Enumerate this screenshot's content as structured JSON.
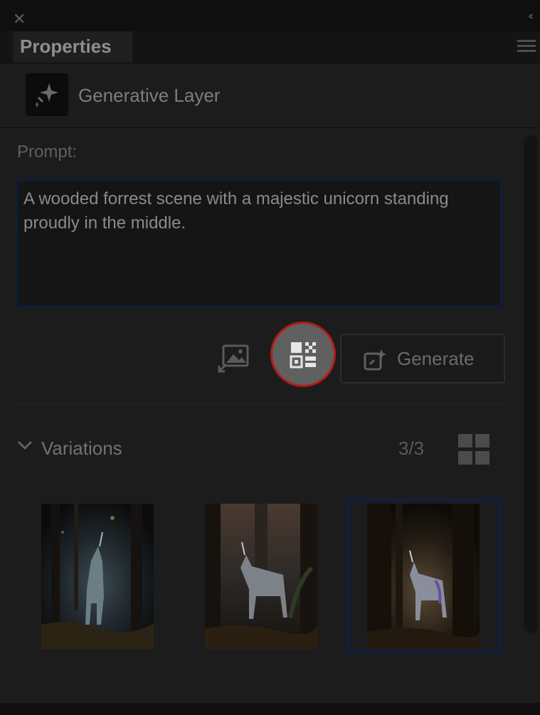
{
  "window": {
    "close_glyph": "✕",
    "collapse_glyph": "‹‹"
  },
  "tabs": {
    "active_label": "Properties"
  },
  "layer": {
    "title": "Generative Layer",
    "icon": "sparkle-layer-icon"
  },
  "prompt": {
    "label": "Prompt:",
    "value": "A wooded forrest scene with a majestic unicorn standing proudly in the middle."
  },
  "actions": {
    "reference_image_icon": "image-reference-icon",
    "highlighted_button_icon": "qr-pattern-icon",
    "generate_label": "Generate",
    "generate_icon": "generate-sparkle-icon"
  },
  "variations": {
    "label": "Variations",
    "count": "3/3",
    "view_icon": "grid-view-icon",
    "selected_index": 2,
    "items": [
      {
        "name": "variation-1"
      },
      {
        "name": "variation-2"
      },
      {
        "name": "variation-3"
      }
    ]
  },
  "colors": {
    "background": "#1c1c1c",
    "highlight_ring": "#b51a1a",
    "selection_border": "#0d1e4a",
    "text_primary": "#8a8a8a"
  }
}
